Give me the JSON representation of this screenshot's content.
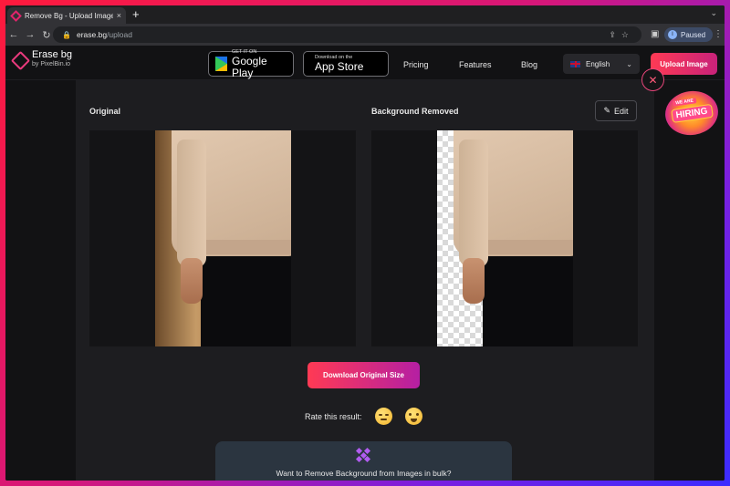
{
  "browser": {
    "tab_title": "Remove Bg - Upload Images to",
    "new_tab": "+",
    "tab_close": "×",
    "url_host": "erase.bg",
    "url_path": "/upload",
    "profile_initial": "I",
    "profile_status": "Paused"
  },
  "header": {
    "logo_name": "Erase bg",
    "logo_by": "by PixelBin.io",
    "google_play_small": "GET IT ON",
    "google_play_big": "Google Play",
    "app_store_small": "Download on the",
    "app_store_big": "App Store",
    "nav": [
      "Pricing",
      "Features",
      "Blog"
    ],
    "language": "English",
    "upload_button": "Upload Image"
  },
  "main": {
    "original_label": "Original",
    "removed_label": "Background Removed",
    "edit_button": "Edit",
    "download_button": "Download Original Size",
    "rate_label": "Rate this result:",
    "bulk_text": "Want to Remove Background from Images in bulk?",
    "hiring_badge_top": "WE ARE",
    "hiring_badge": "HIRING"
  }
}
